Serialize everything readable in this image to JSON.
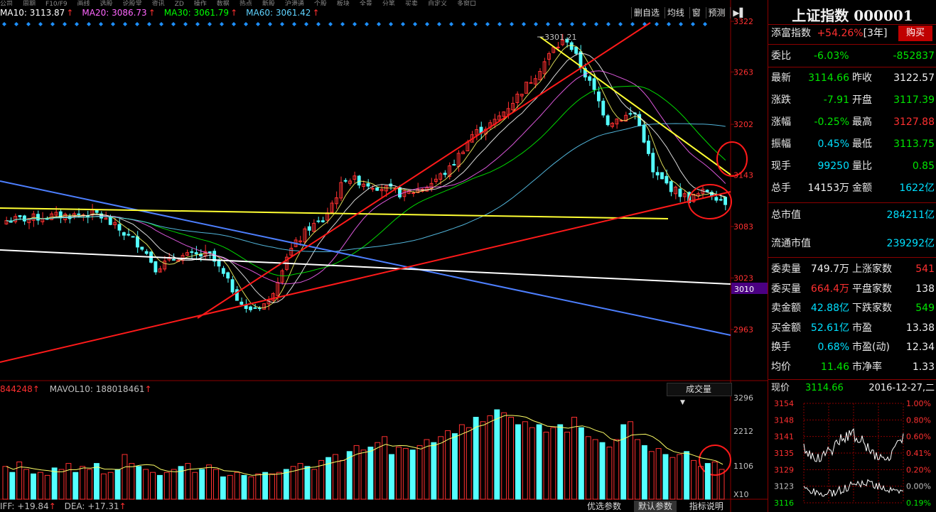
{
  "top_nav": [
    "公司",
    "周期",
    "F10/F9",
    "画线",
    "选股",
    "论股堂",
    "资讯",
    "ZD",
    "操作",
    "数据",
    "热点",
    "新股",
    "沪港通",
    "个股",
    "板块",
    "全景",
    "分笔",
    "买卖",
    "自定义",
    "多窗口"
  ],
  "ma_indicators": [
    {
      "label": "MA10: 3113.87",
      "color": "#ffffff"
    },
    {
      "label": "MA20: 3086.73",
      "color": "#ff66ff"
    },
    {
      "label": "MA30: 3061.79",
      "color": "#00ff00"
    },
    {
      "label": "MA60: 3061.42",
      "color": "#5fd3ff"
    }
  ],
  "toolbar": {
    "delete_self": "删自选",
    "ma_line": "均线",
    "window": "窗",
    "forecast": "预测"
  },
  "price_axis": {
    "ticks": [
      "3322",
      "3263",
      "3202",
      "3143",
      "3083",
      "3023",
      "2963"
    ],
    "current_label": "3010",
    "peak_label": "3301.21"
  },
  "volume": {
    "header_left": "844248",
    "mavol_label": "MAVOL10: 188018461",
    "select_label": "成交量",
    "axis_ticks": [
      "3296",
      "2212",
      "1106"
    ],
    "unit": "X10",
    "bars": [
      0.22,
      0.18,
      0.25,
      0.2,
      0.17,
      0.18,
      0.16,
      0.21,
      0.2,
      0.24,
      0.18,
      0.22,
      0.2,
      0.24,
      0.17,
      0.18,
      0.2,
      0.3,
      0.24,
      0.22,
      0.2,
      0.18,
      0.16,
      0.18,
      0.2,
      0.22,
      0.24,
      0.18,
      0.2,
      0.23,
      0.2,
      0.15,
      0.16,
      0.18,
      0.16,
      0.15,
      0.17,
      0.18,
      0.17,
      0.18,
      0.2,
      0.22,
      0.24,
      0.22,
      0.2,
      0.26,
      0.28,
      0.3,
      0.26,
      0.32,
      0.36,
      0.33,
      0.35,
      0.38,
      0.42,
      0.3,
      0.35,
      0.34,
      0.33,
      0.36,
      0.4,
      0.38,
      0.42,
      0.46,
      0.44,
      0.5,
      0.48,
      0.55,
      0.52,
      0.56,
      0.6,
      0.58,
      0.55,
      0.5,
      0.52,
      0.48,
      0.5,
      0.45,
      0.48,
      0.5,
      0.45,
      0.55,
      0.48,
      0.42,
      0.4,
      0.38,
      0.35,
      0.4,
      0.5,
      0.52,
      0.4,
      0.36,
      0.32,
      0.34,
      0.3,
      0.28,
      0.3,
      0.32,
      0.26,
      0.22,
      0.24,
      0.25,
      0.2
    ]
  },
  "macd": {
    "dif_label": "IFF: +19.84",
    "dea_label": "DEA: +17.31"
  },
  "bottom_tabs": [
    "优选参数",
    "默认参数",
    "指标说明"
  ],
  "panel": {
    "title": "上证指数 000001",
    "tianfu_label": "添富指数",
    "tianfu_value": "+54.26%",
    "tianfu_period": "[3年]",
    "buy_button": "购买",
    "weibi_label": "委比",
    "weibi_pct": "-6.03%",
    "weibi_val": "-852837",
    "quote_rows": [
      {
        "l1": "最新",
        "v1": "3114.66",
        "c1": "green",
        "l2": "昨收",
        "v2": "3122.57",
        "c2": "white"
      },
      {
        "l1": "涨跌",
        "v1": "-7.91",
        "c1": "green",
        "l2": "开盘",
        "v2": "3117.39",
        "c2": "green"
      },
      {
        "l1": "涨幅",
        "v1": "-0.25%",
        "c1": "green",
        "l2": "最高",
        "v2": "3127.88",
        "c2": "red"
      },
      {
        "l1": "振幅",
        "v1": "0.45%",
        "c1": "cyan",
        "l2": "最低",
        "v2": "3113.75",
        "c2": "green"
      },
      {
        "l1": "现手",
        "v1": "99250",
        "c1": "cyan",
        "l2": "量比",
        "v2": "0.85",
        "c2": "green"
      },
      {
        "l1": "总手",
        "v1": "14153万",
        "c1": "white",
        "l2": "金额",
        "v2": "1622亿",
        "c2": "cyan"
      }
    ],
    "total_mv_label": "总市值",
    "total_mv_value": "284211亿",
    "float_mv_label": "流通市值",
    "float_mv_value": "239292亿",
    "stat_rows": [
      {
        "l1": "委卖量",
        "v1": "749.7万",
        "c1": "white",
        "l2": "上涨家数",
        "v2": "541",
        "c2": "red"
      },
      {
        "l1": "委买量",
        "v1": "664.4万",
        "c1": "red",
        "l2": "平盘家数",
        "v2": "138",
        "c2": "white"
      },
      {
        "l1": "卖金额",
        "v1": "42.88亿",
        "c1": "cyan",
        "l2": "下跌家数",
        "v2": "549",
        "c2": "green"
      },
      {
        "l1": "买金额",
        "v1": "52.61亿",
        "c1": "cyan",
        "l2": "市盈",
        "v2": "13.38",
        "c2": "white"
      },
      {
        "l1": "换手",
        "v1": "0.68%",
        "c1": "cyan",
        "l2": "市盈(动)",
        "v2": "12.34",
        "c2": "white"
      },
      {
        "l1": "均价",
        "v1": "11.46",
        "c1": "green",
        "l2": "市净率",
        "v2": "1.33",
        "c2": "white"
      }
    ],
    "current_price_label": "现价",
    "current_price_value": "3114.66",
    "current_date": "2016-12-27,二",
    "mini_left_ticks": [
      "3154",
      "3148",
      "3141",
      "3135",
      "3129",
      "3123",
      "3116"
    ],
    "mini_right_ticks": [
      "1.00%",
      "0.80%",
      "0.60%",
      "0.41%",
      "0.20%",
      "0.00%",
      "0.19%"
    ]
  },
  "colors": {
    "up": "#ff3030",
    "down": "#54ffff",
    "trend_red": "#ff1a1a",
    "trend_yellow": "#ffff33",
    "trend_blue": "#4d7fff",
    "trend_white": "#ffffff",
    "ma10": "#ffffff",
    "ma20": "#ff66ff",
    "ma30": "#00ff00",
    "ma60": "#5fd3ff",
    "ma_yellow": "#ffff66"
  }
}
